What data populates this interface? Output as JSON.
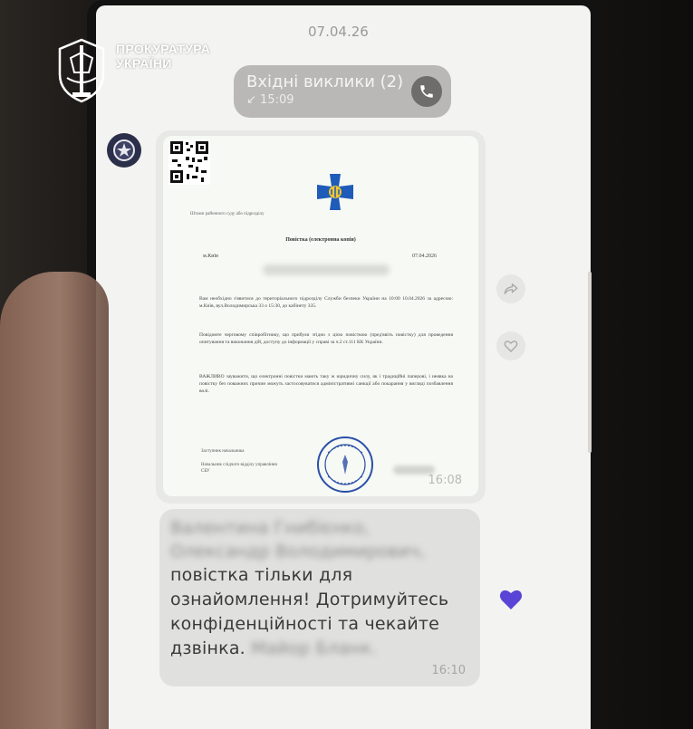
{
  "watermark": {
    "line1": "ПРОКУРАТУРА",
    "line2": "УКРАЇНИ"
  },
  "chat": {
    "date_separator": "07.04.26",
    "call": {
      "title": "Вхідні виклики (2)",
      "time": "15:09",
      "direction_icon": "incoming-arrow-icon",
      "action_icon": "phone-icon"
    },
    "document_message": {
      "time": "16:08",
      "doc": {
        "header_small": "Штамп районного суду або підрозділу",
        "title": "Повістка (електронна копія)",
        "city": "м.Київ",
        "date": "07.04.2026",
        "para1": "Вам необхідно з'явитися до територіального підрозділу Служби безпеки України на 10:00 10.04.2026 за адресою: м.Київ, вул.Володимирська 33 о 15:30, до кабінету 335.",
        "para2": "Повідомте черговому співробітнику, що прибули згідно з цією повісткою (пред'явіть повістку) для проведення опитування та виконання дій, доступу до інформації у справі за ч.2 ст.111 КК України.",
        "para3": "ВАЖЛИВО зауважити, що електронні повістки мають таку ж юридичну силу, як і традиційні паперові, і неявка на повістку без поважних причин можуть застосовуватися адміністративні санкції або покарання у вигляді позбавлення волі.",
        "sig_line1": "Заступник начальника",
        "sig_line2": "Начальник слідчого відділу управління СБУ"
      }
    },
    "text_message": {
      "blurred_line1": "Валентина Гнибієнко,",
      "blurred_line2": "Олександр Володимирович,",
      "text": "повістка тільки для ознайомлення! Дотримуйтесь конфіденційності та чекайте дзвінка.",
      "blurred_signature": "Майор Бланк.",
      "time": "16:10",
      "reaction_icon": "heart-icon"
    },
    "side_actions": [
      "share-icon",
      "heart-outline-icon"
    ]
  },
  "colors": {
    "reaction": "#5a44d6",
    "call_bubble": "#b9b8b6",
    "screen_bg": "#f3f3f1"
  }
}
